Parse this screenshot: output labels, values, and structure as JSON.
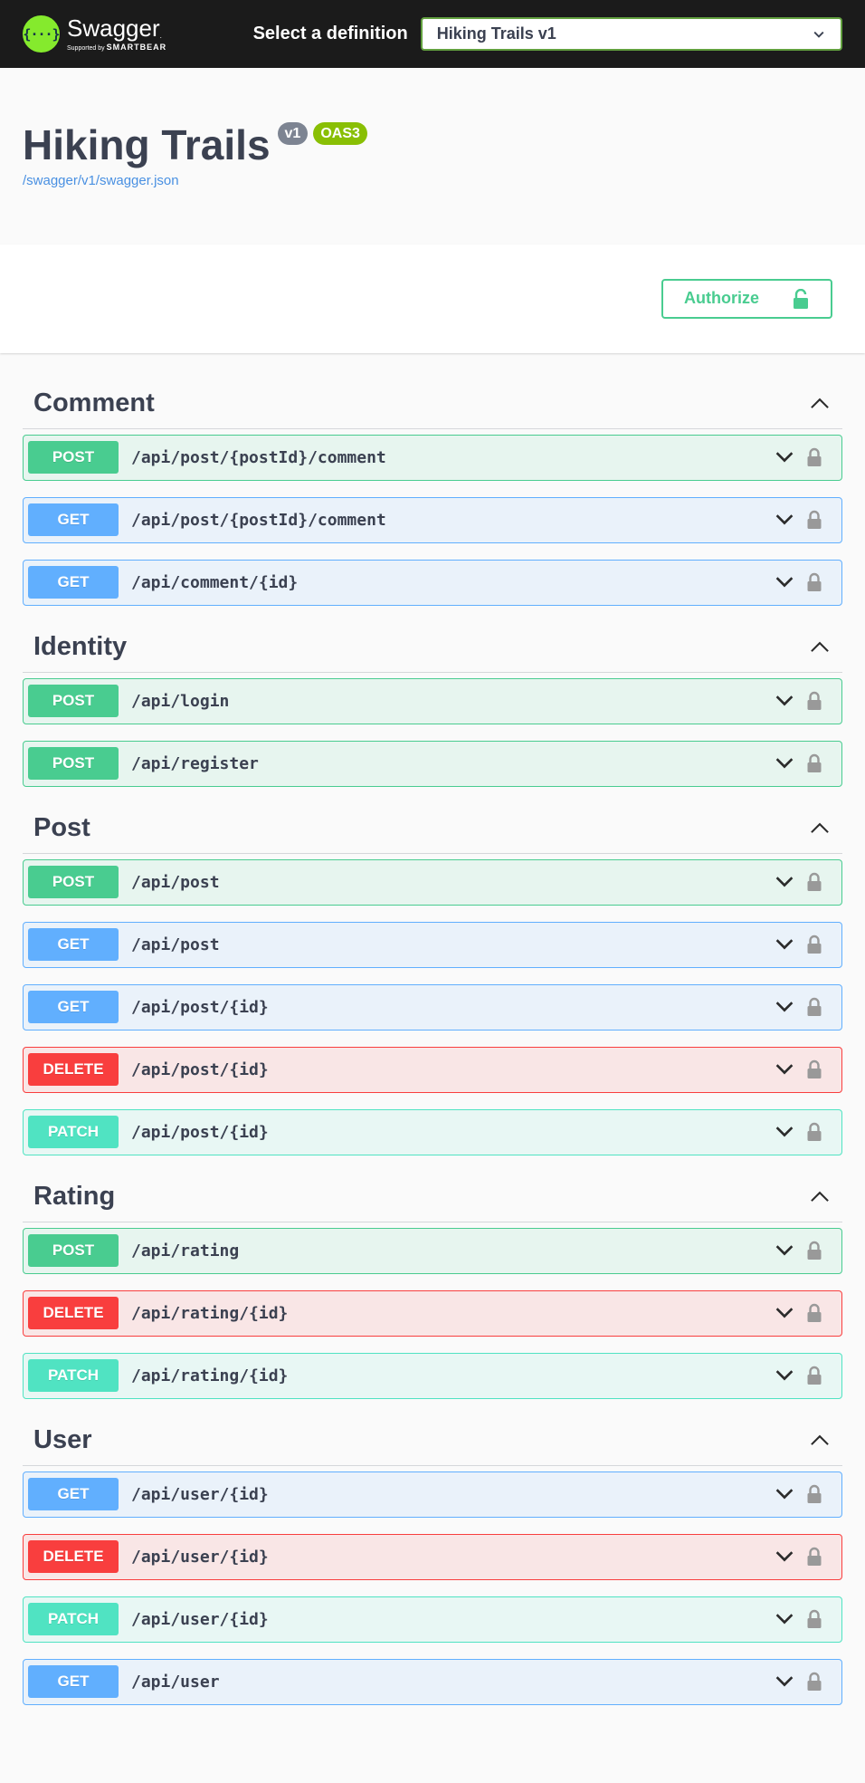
{
  "topbar": {
    "brand_name": "Swagger",
    "brand_logo_glyph": "{···}",
    "brand_sub_prefix": "Supported by",
    "brand_sub_company": "SMARTBEAR",
    "definition_label": "Select a definition",
    "definition_value": "Hiking Trails v1"
  },
  "info": {
    "title": "Hiking Trails",
    "version_badge": "v1",
    "oas_badge": "OAS3",
    "spec_link": "/swagger/v1/swagger.json"
  },
  "scheme": {
    "authorize_label": "Authorize"
  },
  "colors": {
    "post": "#49cc90",
    "get": "#61affe",
    "delete": "#f93e3e",
    "patch": "#50e3c2",
    "topbar": "#1b1b1b",
    "brand": "#85ea2d"
  },
  "icons": {
    "chevron": "chevron-down-icon",
    "collapse": "chevron-up-icon",
    "lock": "lock-icon"
  },
  "sections": [
    {
      "title": "Comment",
      "ops": [
        {
          "method": "POST",
          "path": "/api/post/{postId}/comment"
        },
        {
          "method": "GET",
          "path": "/api/post/{postId}/comment"
        },
        {
          "method": "GET",
          "path": "/api/comment/{id}"
        }
      ]
    },
    {
      "title": "Identity",
      "ops": [
        {
          "method": "POST",
          "path": "/api/login"
        },
        {
          "method": "POST",
          "path": "/api/register"
        }
      ]
    },
    {
      "title": "Post",
      "ops": [
        {
          "method": "POST",
          "path": "/api/post"
        },
        {
          "method": "GET",
          "path": "/api/post"
        },
        {
          "method": "GET",
          "path": "/api/post/{id}"
        },
        {
          "method": "DELETE",
          "path": "/api/post/{id}"
        },
        {
          "method": "PATCH",
          "path": "/api/post/{id}"
        }
      ]
    },
    {
      "title": "Rating",
      "ops": [
        {
          "method": "POST",
          "path": "/api/rating"
        },
        {
          "method": "DELETE",
          "path": "/api/rating/{id}"
        },
        {
          "method": "PATCH",
          "path": "/api/rating/{id}"
        }
      ]
    },
    {
      "title": "User",
      "ops": [
        {
          "method": "GET",
          "path": "/api/user/{id}"
        },
        {
          "method": "DELETE",
          "path": "/api/user/{id}"
        },
        {
          "method": "PATCH",
          "path": "/api/user/{id}"
        },
        {
          "method": "GET",
          "path": "/api/user"
        }
      ]
    }
  ]
}
